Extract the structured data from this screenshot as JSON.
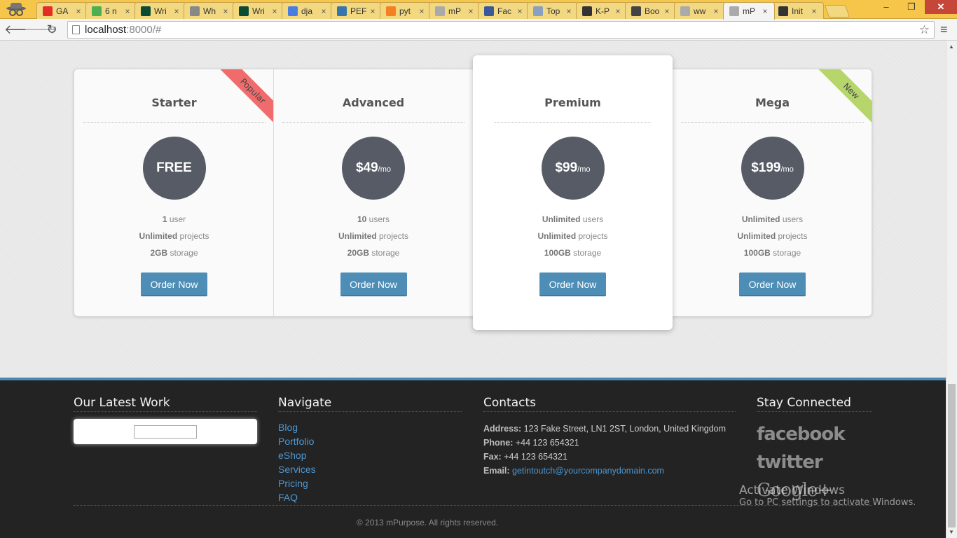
{
  "browser": {
    "tabs": [
      {
        "title": "GA",
        "favicon": "youtube-icon",
        "color": "#e52d27"
      },
      {
        "title": "6 n",
        "favicon": "refresh-green-icon",
        "color": "#4caf50"
      },
      {
        "title": "Wri",
        "favicon": "django-icon",
        "color": "#0c4b33"
      },
      {
        "title": "Wh",
        "favicon": "page-grid-icon",
        "color": "#888888"
      },
      {
        "title": "Wri",
        "favicon": "django-icon",
        "color": "#0c4b33"
      },
      {
        "title": "dja",
        "favicon": "google-icon",
        "color": "#4a7de0"
      },
      {
        "title": "PEF",
        "favicon": "python-icon",
        "color": "#3776ab"
      },
      {
        "title": "pyt",
        "favicon": "stackoverflow-icon",
        "color": "#f48024"
      },
      {
        "title": "mP",
        "favicon": "page-icon",
        "color": "#aaaaaa"
      },
      {
        "title": "Fac",
        "favicon": "facebook-icon",
        "color": "#3b5998"
      },
      {
        "title": "Top",
        "favicon": "zotero-icon",
        "color": "#8aa0c0"
      },
      {
        "title": "K-P",
        "favicon": "github-icon",
        "color": "#333333"
      },
      {
        "title": "Boo",
        "favicon": "bootstrap-icon",
        "color": "#444444"
      },
      {
        "title": "ww",
        "favicon": "page-icon",
        "color": "#aaaaaa"
      },
      {
        "title": "mP",
        "favicon": "page-icon",
        "color": "#aaaaaa",
        "active": true
      },
      {
        "title": "Init",
        "favicon": "github-icon",
        "color": "#333333"
      }
    ],
    "close_glyph": "×",
    "window_controls": {
      "minimize": "–",
      "restore": "❐",
      "close": "✕"
    },
    "url_host": "localhost",
    "url_path": ":8000/#",
    "back_glyph": "🡐",
    "forward_glyph": "🡒",
    "reload_glyph": "↻",
    "star_glyph": "☆",
    "menu_glyph": "≡"
  },
  "pricing": {
    "order_label": "Order Now",
    "plans": [
      {
        "name": "Starter",
        "price": "FREE",
        "per": "",
        "features": [
          [
            "1",
            " user"
          ],
          [
            "Unlimited",
            " projects"
          ],
          [
            "2GB",
            " storage"
          ]
        ],
        "ribbon": "Popular"
      },
      {
        "name": "Advanced",
        "price": "$49",
        "per": "/mo",
        "features": [
          [
            "10",
            " users"
          ],
          [
            "Unlimited",
            " projects"
          ],
          [
            "20GB",
            " storage"
          ]
        ]
      },
      {
        "name": "Premium",
        "price": "$99",
        "per": "/mo",
        "features": [
          [
            "Unlimited",
            " users"
          ],
          [
            "Unlimited",
            " projects"
          ],
          [
            "100GB",
            " storage"
          ]
        ]
      },
      {
        "name": "Mega",
        "price": "$199",
        "per": "/mo",
        "features": [
          [
            "Unlimited",
            " users"
          ],
          [
            "Unlimited",
            " projects"
          ],
          [
            "100GB",
            " storage"
          ]
        ],
        "ribbon": "New"
      }
    ]
  },
  "footer": {
    "latest_work_title": "Our Latest Work",
    "navigate_title": "Navigate",
    "nav_links": [
      "Blog",
      "Portfolio",
      "eShop",
      "Services",
      "Pricing",
      "FAQ"
    ],
    "contacts_title": "Contacts",
    "contacts": {
      "address_label": "Address:",
      "address": " 123 Fake Street, LN1 2ST, London, United Kingdom",
      "phone_label": "Phone:",
      "phone": " +44 123 654321",
      "fax_label": "Fax:",
      "fax": " +44 123 654321",
      "email_label": "Email:",
      "email": "getintoutch@yourcompanydomain.com"
    },
    "social_title": "Stay Connected",
    "social": [
      "facebook",
      "twitter",
      "Google+"
    ],
    "copyright": "© 2013 mPurpose. All rights reserved."
  },
  "watermark": {
    "line1": "Activate Windows",
    "line2": "Go to PC settings to activate Windows."
  }
}
